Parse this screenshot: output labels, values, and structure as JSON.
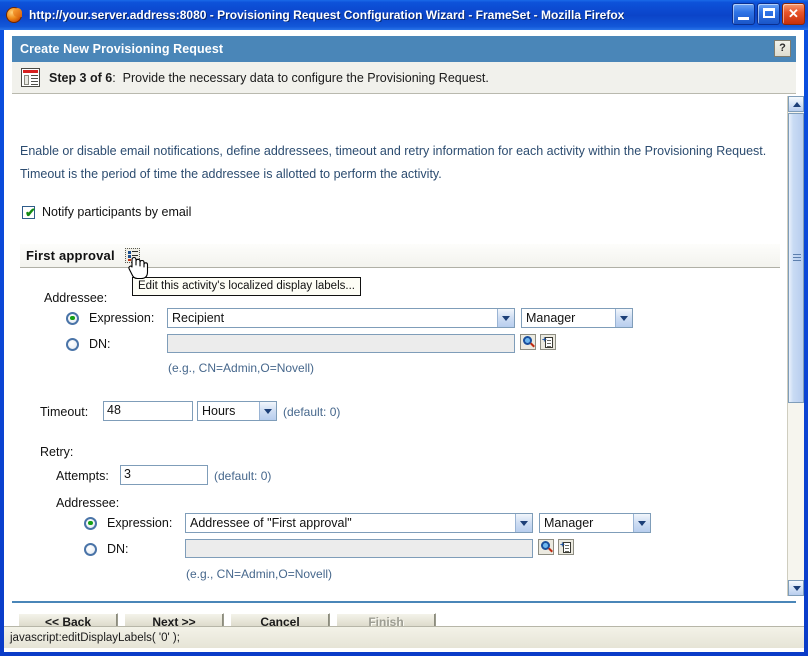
{
  "window": {
    "title": "http://your.server.address:8080 - Provisioning Request Configuration Wizard - FrameSet - Mozilla Firefox",
    "minimize_label": "Minimize",
    "maximize_label": "Maximize",
    "close_label": "Close"
  },
  "app_header": {
    "title": "Create New Provisioning Request",
    "help_label": "?"
  },
  "step_bar": {
    "step_label": "Step 3 of 6",
    "step_separator": ":",
    "step_description": "Provide the necessary data to configure the Provisioning Request."
  },
  "instructions": {
    "text": "Enable or disable email notifications, define addressees, timeout and retry information for each activity within the Provisioning Request.  Timeout is the period of time the addressee is allotted to perform the activity."
  },
  "notify": {
    "label": "Notify participants by email",
    "checked": true
  },
  "section": {
    "title": "First approval",
    "edit_labels_tooltip": "Edit this activity's localized display labels..."
  },
  "addressee_primary": {
    "group_label": "Addressee:",
    "expression_label": "Expression:",
    "expression_value": "Recipient",
    "expression_qualifier": "Manager",
    "dn_label": "DN:",
    "dn_value": "",
    "dn_hint": "(e.g., CN=Admin,O=Novell)",
    "selected": "expression",
    "lookup_icon": "magnifier-icon",
    "history_icon": "clipboard-icon"
  },
  "timeout": {
    "label": "Timeout:",
    "value": "48",
    "unit": "Hours",
    "default_hint": "(default: 0)"
  },
  "retry": {
    "group_label": "Retry:",
    "attempts_label": "Attempts:",
    "attempts_value": "3",
    "attempts_default_hint": "(default: 0)"
  },
  "addressee_retry": {
    "group_label": "Addressee:",
    "expression_label": "Expression:",
    "expression_value": "Addressee of \"First approval\"",
    "expression_qualifier": "Manager",
    "dn_label": "DN:",
    "dn_value": "",
    "dn_hint": "(e.g., CN=Admin,O=Novell)",
    "selected": "expression",
    "lookup_icon": "magnifier-icon",
    "history_icon": "clipboard-icon"
  },
  "buttons": {
    "back": "<< Back",
    "next": "Next >>",
    "cancel": "Cancel",
    "finish": "Finish",
    "finish_disabled": true
  },
  "statusbar": {
    "text": "javascript:editDisplayLabels( '0' );"
  },
  "colors": {
    "header_blue": "#4a86b8",
    "title_blue": "#0b46d6",
    "instruction_text": "#2c4c70",
    "hint_text": "#46678c",
    "radio_on": "#17a017",
    "check_green": "#128a12"
  }
}
